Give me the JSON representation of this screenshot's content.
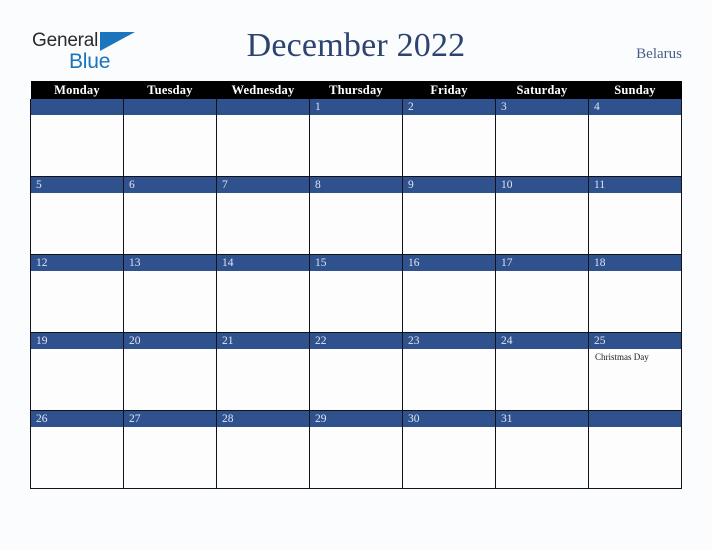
{
  "brand": {
    "name_part1": "General",
    "name_part2": "Blue",
    "triangle_color": "#1b74bc",
    "text_color": "#2b2b2b"
  },
  "header": {
    "title": "December 2022",
    "country": "Belarus",
    "title_color": "#2d4370",
    "country_color": "#4a5e85"
  },
  "colors": {
    "weekday_header_bg": "#000000",
    "weekday_header_text": "#ffffff",
    "date_bar_bg": "#2f528f",
    "date_bar_text": "#dfe5ef",
    "cell_bg": "#fdfdfd",
    "grid_line": "#111318",
    "page_bg": "#fbfcfd"
  },
  "calendar": {
    "month": "December",
    "year": "2022",
    "weekdays": [
      "Monday",
      "Tuesday",
      "Wednesday",
      "Thursday",
      "Friday",
      "Saturday",
      "Sunday"
    ],
    "weeks": [
      [
        {
          "day": "",
          "event": ""
        },
        {
          "day": "",
          "event": ""
        },
        {
          "day": "",
          "event": ""
        },
        {
          "day": "1",
          "event": ""
        },
        {
          "day": "2",
          "event": ""
        },
        {
          "day": "3",
          "event": ""
        },
        {
          "day": "4",
          "event": ""
        }
      ],
      [
        {
          "day": "5",
          "event": ""
        },
        {
          "day": "6",
          "event": ""
        },
        {
          "day": "7",
          "event": ""
        },
        {
          "day": "8",
          "event": ""
        },
        {
          "day": "9",
          "event": ""
        },
        {
          "day": "10",
          "event": ""
        },
        {
          "day": "11",
          "event": ""
        }
      ],
      [
        {
          "day": "12",
          "event": ""
        },
        {
          "day": "13",
          "event": ""
        },
        {
          "day": "14",
          "event": ""
        },
        {
          "day": "15",
          "event": ""
        },
        {
          "day": "16",
          "event": ""
        },
        {
          "day": "17",
          "event": ""
        },
        {
          "day": "18",
          "event": ""
        }
      ],
      [
        {
          "day": "19",
          "event": ""
        },
        {
          "day": "20",
          "event": ""
        },
        {
          "day": "21",
          "event": ""
        },
        {
          "day": "22",
          "event": ""
        },
        {
          "day": "23",
          "event": ""
        },
        {
          "day": "24",
          "event": ""
        },
        {
          "day": "25",
          "event": "Christmas Day"
        }
      ],
      [
        {
          "day": "26",
          "event": ""
        },
        {
          "day": "27",
          "event": ""
        },
        {
          "day": "28",
          "event": ""
        },
        {
          "day": "29",
          "event": ""
        },
        {
          "day": "30",
          "event": ""
        },
        {
          "day": "31",
          "event": ""
        },
        {
          "day": "",
          "event": ""
        }
      ]
    ]
  }
}
